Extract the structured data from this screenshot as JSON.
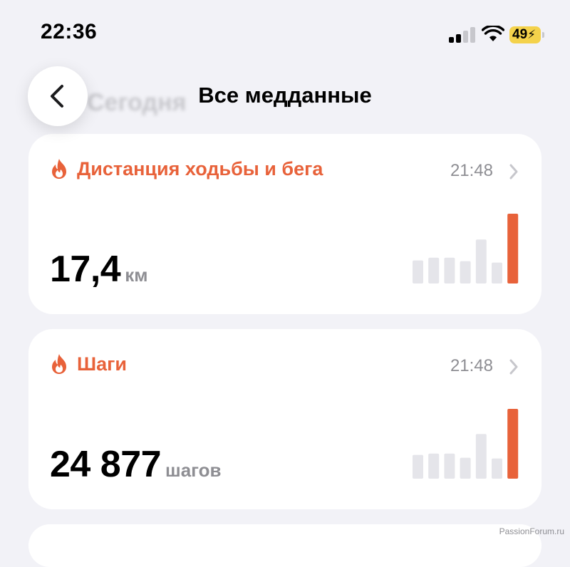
{
  "status_bar": {
    "time": "22:36",
    "battery": "49"
  },
  "nav": {
    "title": "Все медданные",
    "ghost_title": "Сегодня"
  },
  "cards": [
    {
      "title": "Дистанция ходьбы и бега",
      "time": "21:48",
      "value": "17,4",
      "unit": "км",
      "chart_data": {
        "type": "bar",
        "values": [
          0.33,
          0.37,
          0.37,
          0.32,
          0.63,
          0.3,
          1.0
        ],
        "highlight_index": 6
      }
    },
    {
      "title": "Шаги",
      "time": "21:48",
      "value": "24 877",
      "unit": "шагов",
      "chart_data": {
        "type": "bar",
        "values": [
          0.34,
          0.36,
          0.36,
          0.3,
          0.64,
          0.29,
          1.0
        ],
        "highlight_index": 6
      }
    }
  ],
  "colors": {
    "accent": "#e8623a",
    "bar_inactive": "#e5e5ea",
    "secondary_text": "#8e8e93",
    "battery": "#f4d24b"
  },
  "watermark": "PassionForum.ru"
}
